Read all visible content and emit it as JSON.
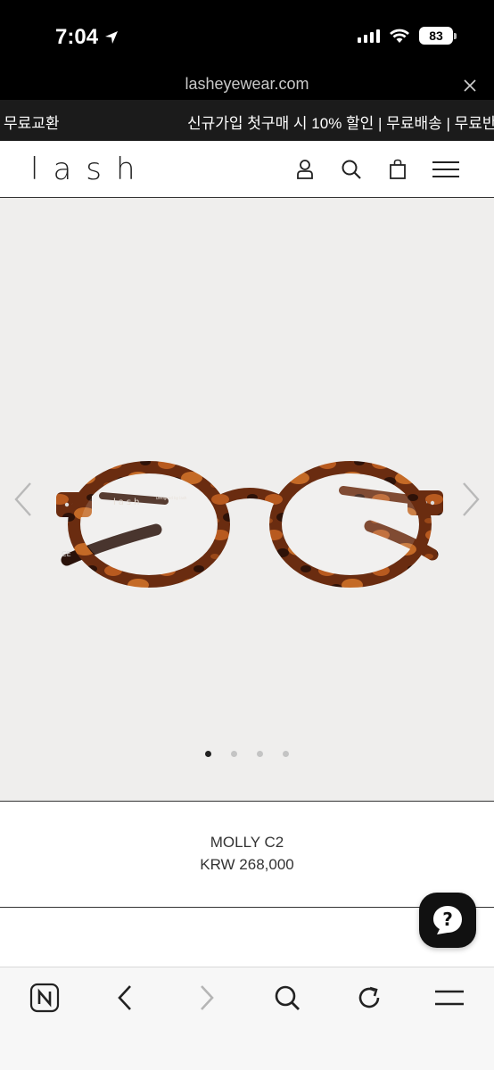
{
  "status_bar": {
    "time": "7:04",
    "battery": "83"
  },
  "url_bar": {
    "url": "lasheyewear.com"
  },
  "banner": {
    "left_text": "무료교환",
    "right_text": "신규가입 첫구매 시 10% 할인 | 무료배송 | 무료반"
  },
  "header": {
    "logo": "lash",
    "icons": [
      "user-icon",
      "search-icon",
      "bag-icon",
      "menu-icon"
    ]
  },
  "gallery": {
    "dots": 4,
    "active_index": 0,
    "frame_text": "lash",
    "frame_small_text": "Designed by lash"
  },
  "product": {
    "name": "MOLLY C2",
    "price": "KRW 268,000"
  },
  "browser_bar": {
    "icons": [
      "naver-icon",
      "back-icon",
      "forward-icon",
      "search-icon",
      "reload-icon",
      "menu-icon"
    ]
  },
  "colors": {
    "tortoise_dark": "#3a1a0e",
    "tortoise_mid": "#7a3414",
    "tortoise_light": "#b85a1f",
    "gallery_bg": "#efeeed"
  }
}
